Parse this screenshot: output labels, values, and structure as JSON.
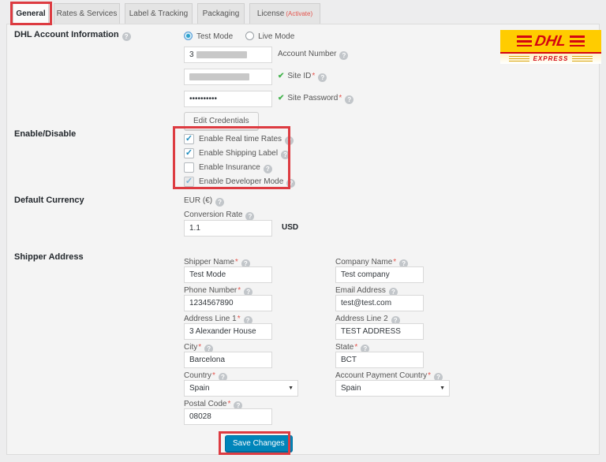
{
  "tabs": {
    "general": "General",
    "rates_services": "Rates & Services",
    "label_tracking": "Label & Tracking",
    "packaging": "Packaging",
    "license": "License",
    "license_suffix": "(Activate)",
    "active_tab": "General"
  },
  "logo": {
    "brand": "DHL",
    "subtitle": "EXPRESS"
  },
  "account": {
    "title": "DHL Account Information",
    "modes": {
      "test": "Test Mode",
      "live": "Live Mode",
      "selected": "Test Mode"
    },
    "account_number": {
      "label": "Account Number",
      "visible_value": "3",
      "redacted": true
    },
    "site_id": {
      "label": "Site ID",
      "required_mark": "*",
      "redacted": true,
      "valid": true
    },
    "site_password": {
      "label": "Site Password",
      "required_mark": "*",
      "value": "••••••••••",
      "valid": true
    },
    "edit_button": "Edit Credentials"
  },
  "enable": {
    "title": "Enable/Disable",
    "real_time_rates": {
      "label": "Enable Real time Rates",
      "checked": true
    },
    "shipping_label": {
      "label": "Enable Shipping Label",
      "checked": true
    },
    "insurance": {
      "label": "Enable Insurance",
      "checked": false
    },
    "developer_mode": {
      "label": "Enable Developer Mode",
      "checked": true,
      "disabled": true
    }
  },
  "currency": {
    "title": "Default Currency",
    "current": "EUR (€)",
    "conversion_rate_label": "Conversion Rate",
    "conversion_rate_value": "1.1",
    "conversion_rate_unit": "USD"
  },
  "shipper": {
    "title": "Shipper Address",
    "shipper_name": {
      "label": "Shipper Name",
      "req": "*",
      "value": "Test Mode"
    },
    "company_name": {
      "label": "Company Name",
      "req": "*",
      "value": "Test company"
    },
    "phone_number": {
      "label": "Phone Number",
      "req": "*",
      "value": "1234567890"
    },
    "email_address": {
      "label": "Email Address",
      "req": "",
      "value": "test@test.com"
    },
    "address_line1": {
      "label": "Address Line 1",
      "req": "*",
      "value": "3 Alexander House"
    },
    "address_line2": {
      "label": "Address Line 2",
      "req": "",
      "value": "TEST ADDRESS"
    },
    "city": {
      "label": "City",
      "req": "*",
      "value": "Barcelona"
    },
    "state": {
      "label": "State",
      "req": "*",
      "value": "BCT"
    },
    "country": {
      "label": "Country",
      "req": "*",
      "value": "Spain"
    },
    "account_payment_country": {
      "label": "Account Payment Country",
      "req": "*",
      "value": "Spain"
    },
    "postal_code": {
      "label": "Postal Code",
      "req": "*",
      "value": "08028"
    }
  },
  "footer": {
    "save_button": "Save Changes"
  },
  "colors": {
    "annotation": "#dd3b41",
    "dhl_red": "#d40511",
    "dhl_yellow": "#ffcc00",
    "primary_button": "#0085ba",
    "checkbox_check": "#1e8cbe",
    "valid_check": "#46b450"
  }
}
